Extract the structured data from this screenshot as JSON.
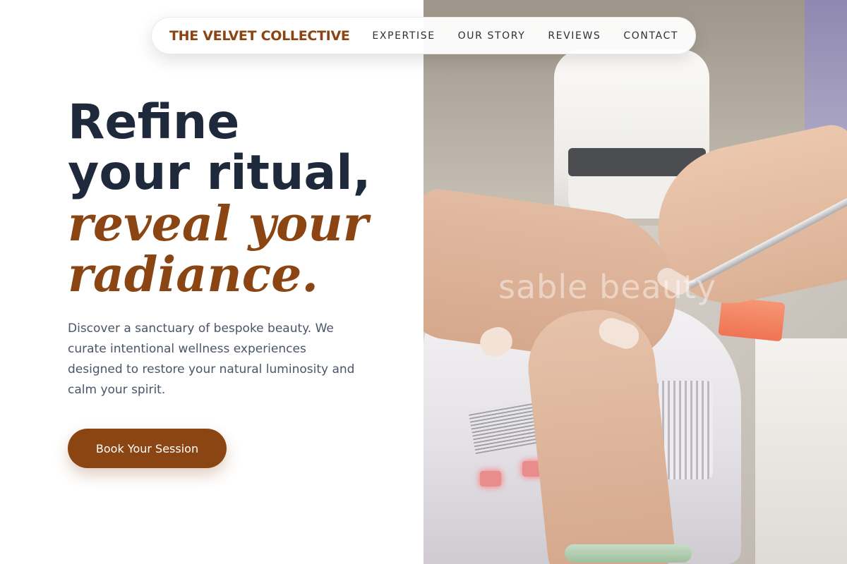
{
  "nav": {
    "brand": "THE VELVET COLLECTIVE",
    "links": [
      "EXPERTISE",
      "OUR STORY",
      "REVIEWS",
      "CONTACT"
    ]
  },
  "hero": {
    "heading_line1": "Refine",
    "heading_line2": "your ritual,",
    "heading_accent_line1": "reveal your",
    "heading_accent_line2": "radiance.",
    "description": "Discover a sanctuary of bespoke beauty. We curate intentional wellness experiences designed to restore your natural luminosity and calm your spirit.",
    "cta_label": "Book Your Session"
  },
  "photo": {
    "watermark": "sable beauty"
  },
  "colors": {
    "accent": "#8b4513",
    "heading": "#1e2a3b",
    "body_text": "#4a5568"
  },
  "icons": []
}
